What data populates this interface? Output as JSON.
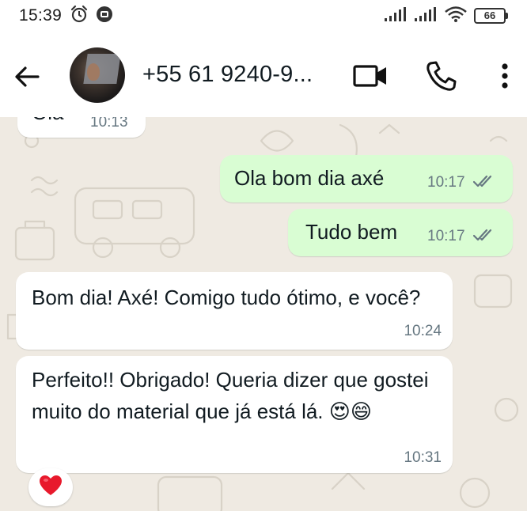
{
  "status_bar": {
    "time": "15:39",
    "battery": "66",
    "icons": [
      "alarm-icon",
      "notification-icon",
      "signal-icon",
      "signal-icon",
      "wifi-icon",
      "battery-icon"
    ]
  },
  "header": {
    "contact": "+55 61 9240-9...",
    "icons": [
      "back-arrow-icon",
      "video-call-icon",
      "voice-call-icon",
      "more-options-icon"
    ]
  },
  "messages": [
    {
      "direction": "incoming",
      "text": "Ola",
      "time": "10:13",
      "partial": true
    },
    {
      "direction": "outgoing",
      "text": "Ola  bom dia axé",
      "time": "10:17",
      "status": "read"
    },
    {
      "direction": "outgoing",
      "text": "Tudo bem",
      "time": "10:17",
      "status": "read"
    },
    {
      "direction": "incoming",
      "text": "Bom dia! Axé! Comigo tudo ótimo, e você?",
      "time": "10:24"
    },
    {
      "direction": "incoming",
      "text": "Perfeito!! Obrigado! Queria dizer que gostei muito do material que já está lá. 😍😄",
      "time": "10:31",
      "reaction": "❤️"
    }
  ],
  "colors": {
    "chat_bg": "#efeae2",
    "incoming_bubble": "#ffffff",
    "outgoing_bubble": "#d9fdd3",
    "read_tick": "#667781"
  }
}
